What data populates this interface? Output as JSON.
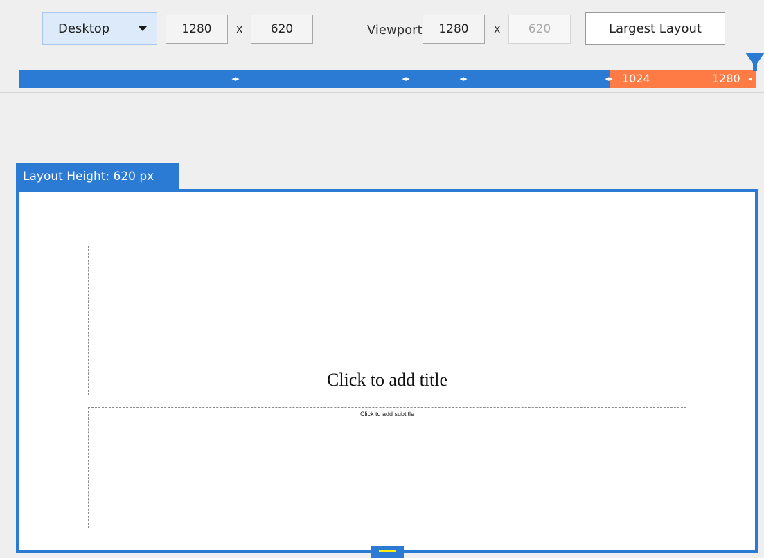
{
  "toolbar": {
    "device_label": "Desktop",
    "layout_width": "1280",
    "layout_height": "620",
    "times_sign": "x",
    "viewport_label": "Viewport",
    "viewport_width": "1280",
    "viewport_height": "620",
    "largest_layout_label": "Largest Layout"
  },
  "breakpoints": {
    "range_start": "1024",
    "range_end": "1280"
  },
  "layout": {
    "tab_label": "Layout Height: 620 px",
    "title_placeholder": "Click to add title",
    "subtitle_placeholder": "Click to add subtitle"
  },
  "colors": {
    "accent_blue": "#2b7ad4",
    "active_breakpoint": "#ff7b45",
    "grip": "#ffee00"
  },
  "icons": {
    "dropdown": "chevron-down-icon",
    "breakpoint_marker": "breakpoint-marker-icon",
    "handle": "viewport-handle-icon"
  }
}
